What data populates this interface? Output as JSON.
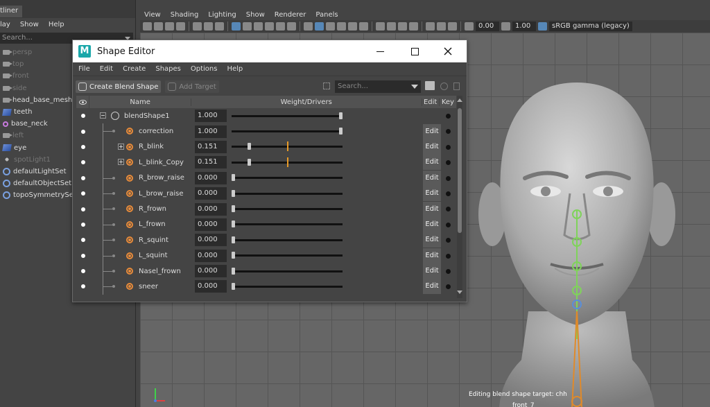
{
  "outliner": {
    "title": "tliner",
    "menu": [
      "lay",
      "Show",
      "Help"
    ],
    "search_placeholder": "Search...",
    "items": [
      {
        "label": "persp",
        "icon": "camera-icon",
        "dim": true
      },
      {
        "label": "top",
        "icon": "camera-icon",
        "dim": true
      },
      {
        "label": "front",
        "icon": "camera-icon",
        "dim": true
      },
      {
        "label": "side",
        "icon": "camera-icon",
        "dim": true
      },
      {
        "label": "head_base_mesh",
        "icon": "camera-icon",
        "dim": false
      },
      {
        "label": "teeth",
        "icon": "mesh-icon",
        "dim": false
      },
      {
        "label": "base_neck",
        "icon": "joint-icon",
        "dim": false
      },
      {
        "label": "left",
        "icon": "camera-icon",
        "dim": true
      },
      {
        "label": "eye",
        "icon": "mesh-icon",
        "dim": false
      },
      {
        "label": "spotLight1",
        "icon": "light-icon",
        "dim": true
      },
      {
        "label": "defaultLightSet",
        "icon": "set-icon",
        "dim": false
      },
      {
        "label": "defaultObjectSet",
        "icon": "set-icon",
        "dim": false
      },
      {
        "label": "topoSymmetrySet",
        "icon": "set-icon",
        "dim": false
      }
    ]
  },
  "viewport": {
    "menu": [
      "View",
      "Shading",
      "Lighting",
      "Show",
      "Renderer",
      "Panels"
    ],
    "exposure": "0.00",
    "gamma": "1.00",
    "color_space": "sRGB gamma (legacy)",
    "status_line1": "Editing blend shape target: chh",
    "status_line2": "front_7",
    "colors": {
      "grid": "#555555",
      "background": "#666666",
      "joint": "#e08a2a",
      "accent": "#5c9ad6"
    }
  },
  "shape_editor": {
    "title": "Shape Editor",
    "logo": "M",
    "menu": [
      "File",
      "Edit",
      "Create",
      "Shapes",
      "Options",
      "Help"
    ],
    "create_blend_shape_label": "Create Blend Shape",
    "add_target_label": "Add Target",
    "search_placeholder": "Search...",
    "columns": {
      "name": "Name",
      "weight": "Weight/Drivers",
      "edit": "Edit",
      "key": "Key"
    },
    "blend_shape": {
      "name": "blendShape1",
      "weight": "1.000",
      "slider": 1.0
    },
    "edit_label": "Edit",
    "targets": [
      {
        "name": "correction",
        "weight": "1.000",
        "slider": 1.0,
        "expandable": false
      },
      {
        "name": "R_blink",
        "weight": "0.151",
        "slider": 0.151,
        "expandable": true,
        "marker": 0.5
      },
      {
        "name": "L_blink_Copy",
        "weight": "0.151",
        "slider": 0.151,
        "expandable": true,
        "marker": 0.5
      },
      {
        "name": "R_brow_raise",
        "weight": "0.000",
        "slider": 0.0,
        "expandable": false
      },
      {
        "name": "L_brow_raise",
        "weight": "0.000",
        "slider": 0.0,
        "expandable": false
      },
      {
        "name": "R_frown",
        "weight": "0.000",
        "slider": 0.0,
        "expandable": false
      },
      {
        "name": "L_frown",
        "weight": "0.000",
        "slider": 0.0,
        "expandable": false
      },
      {
        "name": "R_squint",
        "weight": "0.000",
        "slider": 0.0,
        "expandable": false
      },
      {
        "name": "L_squint",
        "weight": "0.000",
        "slider": 0.0,
        "expandable": false
      },
      {
        "name": "Nasel_frown",
        "weight": "0.000",
        "slider": 0.0,
        "expandable": false
      },
      {
        "name": "sneer",
        "weight": "0.000",
        "slider": 0.0,
        "expandable": false
      }
    ]
  }
}
